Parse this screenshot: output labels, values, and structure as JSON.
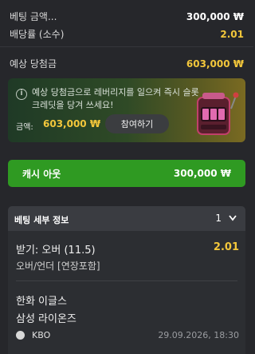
{
  "summary": {
    "stake_label": "베팅 금액...",
    "stake_value": "300,000 ₩",
    "odds_label": "배당률 (소수)",
    "odds_value": "2.01",
    "winnings_label": "예상 당첨금",
    "winnings_value": "603,000 ₩"
  },
  "promo": {
    "message": "예상 당첨금으로 레버리지를 일으켜 즉시 슬롯 크레딧을 당겨 쓰세요!",
    "amount_label": "금액:",
    "amount_value": "603,000 ₩",
    "join_label": "참여하기",
    "info_icon": "i"
  },
  "cashout": {
    "label": "캐시 아웃",
    "value": "300,000 ₩",
    "color": "#2f9a22"
  },
  "details": {
    "title": "베팅 세부 정보",
    "count": "1",
    "pick": "받기: 오버 (11.5)",
    "odds": "2.01",
    "market": "오버/언더 [연장포함]",
    "team_home": "한화 이글스",
    "team_away": "삼성 라이온즈",
    "league": "KBO",
    "datetime": "29.09.2026, 18:30"
  },
  "colors": {
    "accent": "#f3c73b",
    "background": "#26272b"
  }
}
